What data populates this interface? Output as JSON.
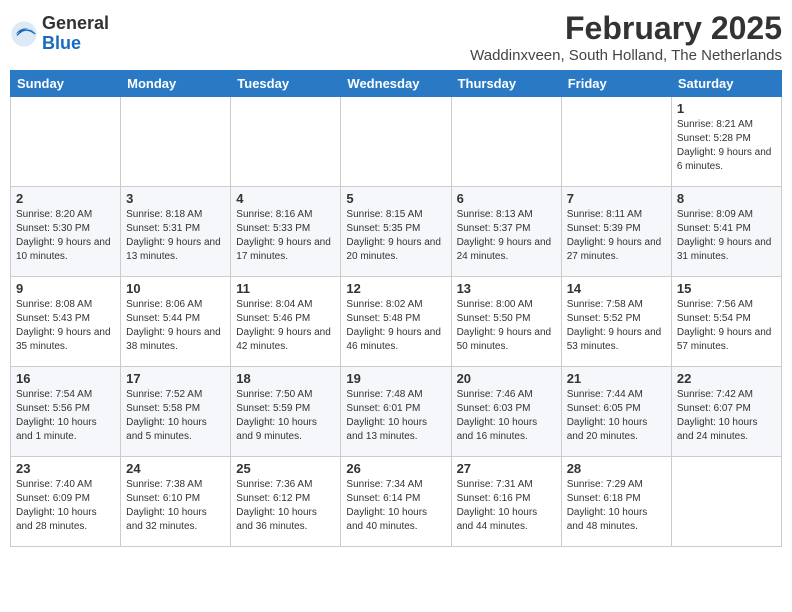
{
  "header": {
    "title": "February 2025",
    "location": "Waddinxveen, South Holland, The Netherlands",
    "logo_general": "General",
    "logo_blue": "Blue"
  },
  "weekdays": [
    "Sunday",
    "Monday",
    "Tuesday",
    "Wednesday",
    "Thursday",
    "Friday",
    "Saturday"
  ],
  "weeks": [
    [
      {
        "day": "",
        "info": ""
      },
      {
        "day": "",
        "info": ""
      },
      {
        "day": "",
        "info": ""
      },
      {
        "day": "",
        "info": ""
      },
      {
        "day": "",
        "info": ""
      },
      {
        "day": "",
        "info": ""
      },
      {
        "day": "1",
        "info": "Sunrise: 8:21 AM\nSunset: 5:28 PM\nDaylight: 9 hours and 6 minutes."
      }
    ],
    [
      {
        "day": "2",
        "info": "Sunrise: 8:20 AM\nSunset: 5:30 PM\nDaylight: 9 hours and 10 minutes."
      },
      {
        "day": "3",
        "info": "Sunrise: 8:18 AM\nSunset: 5:31 PM\nDaylight: 9 hours and 13 minutes."
      },
      {
        "day": "4",
        "info": "Sunrise: 8:16 AM\nSunset: 5:33 PM\nDaylight: 9 hours and 17 minutes."
      },
      {
        "day": "5",
        "info": "Sunrise: 8:15 AM\nSunset: 5:35 PM\nDaylight: 9 hours and 20 minutes."
      },
      {
        "day": "6",
        "info": "Sunrise: 8:13 AM\nSunset: 5:37 PM\nDaylight: 9 hours and 24 minutes."
      },
      {
        "day": "7",
        "info": "Sunrise: 8:11 AM\nSunset: 5:39 PM\nDaylight: 9 hours and 27 minutes."
      },
      {
        "day": "8",
        "info": "Sunrise: 8:09 AM\nSunset: 5:41 PM\nDaylight: 9 hours and 31 minutes."
      }
    ],
    [
      {
        "day": "9",
        "info": "Sunrise: 8:08 AM\nSunset: 5:43 PM\nDaylight: 9 hours and 35 minutes."
      },
      {
        "day": "10",
        "info": "Sunrise: 8:06 AM\nSunset: 5:44 PM\nDaylight: 9 hours and 38 minutes."
      },
      {
        "day": "11",
        "info": "Sunrise: 8:04 AM\nSunset: 5:46 PM\nDaylight: 9 hours and 42 minutes."
      },
      {
        "day": "12",
        "info": "Sunrise: 8:02 AM\nSunset: 5:48 PM\nDaylight: 9 hours and 46 minutes."
      },
      {
        "day": "13",
        "info": "Sunrise: 8:00 AM\nSunset: 5:50 PM\nDaylight: 9 hours and 50 minutes."
      },
      {
        "day": "14",
        "info": "Sunrise: 7:58 AM\nSunset: 5:52 PM\nDaylight: 9 hours and 53 minutes."
      },
      {
        "day": "15",
        "info": "Sunrise: 7:56 AM\nSunset: 5:54 PM\nDaylight: 9 hours and 57 minutes."
      }
    ],
    [
      {
        "day": "16",
        "info": "Sunrise: 7:54 AM\nSunset: 5:56 PM\nDaylight: 10 hours and 1 minute."
      },
      {
        "day": "17",
        "info": "Sunrise: 7:52 AM\nSunset: 5:58 PM\nDaylight: 10 hours and 5 minutes."
      },
      {
        "day": "18",
        "info": "Sunrise: 7:50 AM\nSunset: 5:59 PM\nDaylight: 10 hours and 9 minutes."
      },
      {
        "day": "19",
        "info": "Sunrise: 7:48 AM\nSunset: 6:01 PM\nDaylight: 10 hours and 13 minutes."
      },
      {
        "day": "20",
        "info": "Sunrise: 7:46 AM\nSunset: 6:03 PM\nDaylight: 10 hours and 16 minutes."
      },
      {
        "day": "21",
        "info": "Sunrise: 7:44 AM\nSunset: 6:05 PM\nDaylight: 10 hours and 20 minutes."
      },
      {
        "day": "22",
        "info": "Sunrise: 7:42 AM\nSunset: 6:07 PM\nDaylight: 10 hours and 24 minutes."
      }
    ],
    [
      {
        "day": "23",
        "info": "Sunrise: 7:40 AM\nSunset: 6:09 PM\nDaylight: 10 hours and 28 minutes."
      },
      {
        "day": "24",
        "info": "Sunrise: 7:38 AM\nSunset: 6:10 PM\nDaylight: 10 hours and 32 minutes."
      },
      {
        "day": "25",
        "info": "Sunrise: 7:36 AM\nSunset: 6:12 PM\nDaylight: 10 hours and 36 minutes."
      },
      {
        "day": "26",
        "info": "Sunrise: 7:34 AM\nSunset: 6:14 PM\nDaylight: 10 hours and 40 minutes."
      },
      {
        "day": "27",
        "info": "Sunrise: 7:31 AM\nSunset: 6:16 PM\nDaylight: 10 hours and 44 minutes."
      },
      {
        "day": "28",
        "info": "Sunrise: 7:29 AM\nSunset: 6:18 PM\nDaylight: 10 hours and 48 minutes."
      },
      {
        "day": "",
        "info": ""
      }
    ]
  ]
}
